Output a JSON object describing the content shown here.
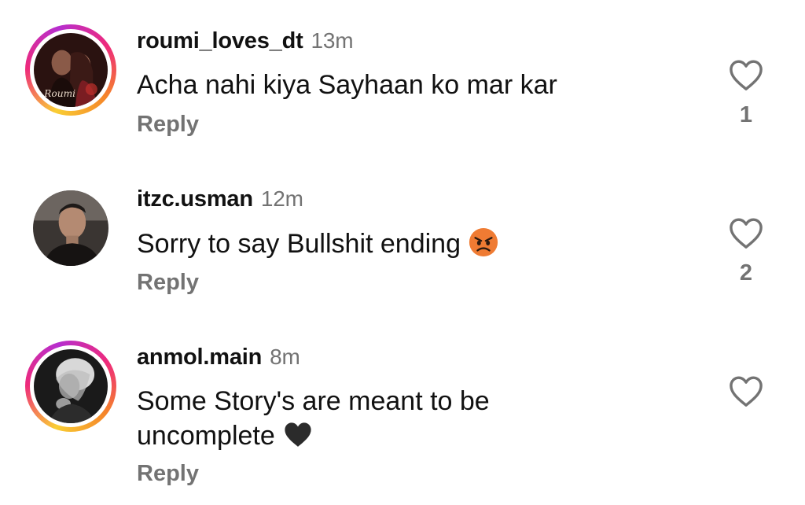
{
  "comments": [
    {
      "username": "roumi_loves_dt",
      "time": "13m",
      "text": "Acha nahi kiya Sayhaan ko mar kar",
      "reply_label": "Reply",
      "likes": "1",
      "avatar_text": "Roumi"
    },
    {
      "username": "itzc.usman",
      "time": "12m",
      "text": "Sorry to say Bullshit ending",
      "emoji": "angry-face",
      "reply_label": "Reply",
      "likes": "2"
    },
    {
      "username": "anmol.main",
      "time": "8m",
      "text_line1": "Some Story's are meant to be",
      "text_line2": "uncomplete",
      "emoji": "black-heart",
      "reply_label": "Reply"
    }
  ]
}
